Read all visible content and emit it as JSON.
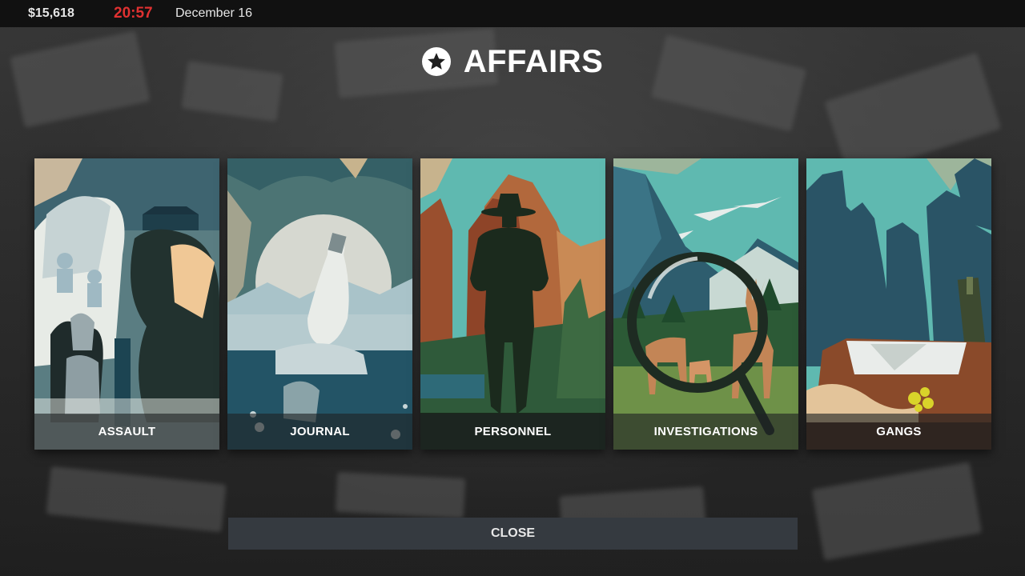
{
  "status_bar": {
    "money": "$15,618",
    "time": "20:57",
    "date": "December 16",
    "time_color": "#e03131"
  },
  "title": {
    "icon": "star-icon",
    "text": "AFFAIRS"
  },
  "cards": [
    {
      "label": "ASSAULT",
      "art": "assault-illustration"
    },
    {
      "label": "JOURNAL",
      "art": "journal-illustration"
    },
    {
      "label": "PERSONNEL",
      "art": "personnel-illustration"
    },
    {
      "label": "INVESTIGATIONS",
      "art": "investigations-illustration"
    },
    {
      "label": "GANGS",
      "art": "gangs-illustration"
    }
  ],
  "close_button": {
    "label": "CLOSE"
  },
  "colors": {
    "topbar": "#111111",
    "button": "#353a40",
    "teal_sky": "#5fb9b0",
    "dark_teal": "#1f4a5a",
    "sand": "#f0c896"
  }
}
